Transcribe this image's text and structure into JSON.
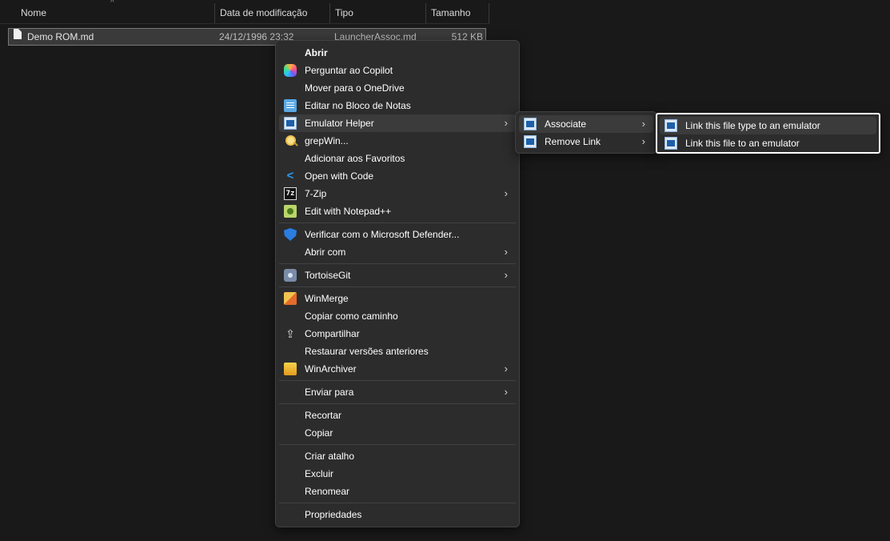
{
  "explorer": {
    "columns": [
      "Nome",
      "Data de modificação",
      "Tipo",
      "Tamanho"
    ],
    "sort_indicator": "^",
    "file": {
      "name": "Demo ROM.md",
      "modified": "24/12/1996 23:32",
      "type": "LauncherAssoc.md",
      "size": "512 KB"
    }
  },
  "context_menu": {
    "items": [
      {
        "label": "Abrir",
        "icon": "none"
      },
      {
        "label": "Perguntar ao Copilot",
        "icon": "copilot-icon"
      },
      {
        "label": "Mover para o OneDrive",
        "icon": "none"
      },
      {
        "label": "Editar no Bloco de Notas",
        "icon": "notepad-icon"
      },
      {
        "label": "Emulator Helper",
        "icon": "emulator-icon"
      },
      {
        "label": "grepWin...",
        "icon": "grepwin-icon"
      },
      {
        "label": "Adicionar aos Favoritos",
        "icon": "none"
      },
      {
        "label": "Open with Code",
        "icon": "vscode-icon"
      },
      {
        "label": "7-Zip",
        "icon": "7zip-icon"
      },
      {
        "label": "Edit with Notepad++",
        "icon": "notepadpp-icon"
      },
      {
        "label": "Verificar com o Microsoft Defender...",
        "icon": "defender-icon"
      },
      {
        "label": "Abrir com",
        "icon": "none"
      },
      {
        "label": "TortoiseGit",
        "icon": "tortoisegit-icon"
      },
      {
        "label": "WinMerge",
        "icon": "winmerge-icon"
      },
      {
        "label": "Copiar como caminho",
        "icon": "none"
      },
      {
        "label": "Compartilhar",
        "icon": "share-icon"
      },
      {
        "label": "Restaurar versões anteriores",
        "icon": "none"
      },
      {
        "label": "WinArchiver",
        "icon": "winarchiver-icon"
      },
      {
        "label": "Enviar para",
        "icon": "none"
      },
      {
        "label": "Recortar",
        "icon": "none"
      },
      {
        "label": "Copiar",
        "icon": "none"
      },
      {
        "label": "Criar atalho",
        "icon": "none"
      },
      {
        "label": "Excluir",
        "icon": "none"
      },
      {
        "label": "Renomear",
        "icon": "none"
      },
      {
        "label": "Propriedades",
        "icon": "none"
      }
    ],
    "zip_icon_text": "7z",
    "submenu_arrow": "›"
  },
  "emulator_submenu": {
    "items": [
      {
        "label": "Associate",
        "icon": "emulator-icon"
      },
      {
        "label": "Remove Link",
        "icon": "emulator-icon"
      }
    ]
  },
  "associate_submenu": {
    "items": [
      {
        "label": "Link this file type to an emulator",
        "icon": "emulator-icon"
      },
      {
        "label": "Link this file to an emulator",
        "icon": "emulator-icon"
      }
    ]
  }
}
